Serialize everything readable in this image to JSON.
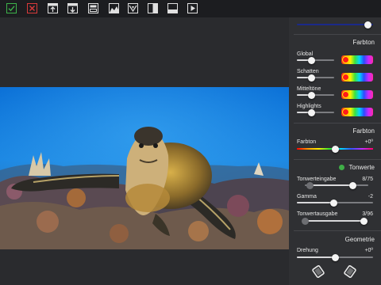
{
  "toolbar": {
    "items": [
      {
        "name": "accept-button",
        "icon": "checkmark-icon",
        "color": "#3db34a"
      },
      {
        "name": "cancel-button",
        "icon": "close-icon",
        "color": "#d93a3a"
      },
      {
        "name": "export-button",
        "icon": "arrow-up-icon"
      },
      {
        "name": "import-button",
        "icon": "arrow-down-icon"
      },
      {
        "name": "compare-button",
        "icon": "split-view-icon"
      },
      {
        "name": "histogram-button",
        "icon": "histogram-icon"
      },
      {
        "name": "auto-adjust-button",
        "icon": "auto-adjust-icon"
      },
      {
        "name": "before-after-button",
        "icon": "before-after-icon"
      },
      {
        "name": "crop-button",
        "icon": "crop-icon"
      },
      {
        "name": "play-button",
        "icon": "play-icon"
      }
    ]
  },
  "panel": {
    "top_slider": {
      "value": 0.93
    },
    "farbton_section": {
      "title": "Farbton",
      "rows": [
        {
          "label": "Global",
          "value": 0.4
        },
        {
          "label": "Schatten",
          "value": 0.4
        },
        {
          "label": "Mitteltöne",
          "value": 0.4
        },
        {
          "label": "Highlights",
          "value": 0.4
        }
      ]
    },
    "farbton2_section": {
      "title": "Farbton",
      "label": "Farbton",
      "value_text": "+0º",
      "value": 0.5
    },
    "tonwerte_section": {
      "title": "Tonwerte",
      "enabled_color": "#3fae47",
      "rows": [
        {
          "label": "Tonwerteingabe",
          "value_text": "8/75",
          "low": 0.08,
          "high": 0.75
        },
        {
          "label": "Gamma",
          "value_text": "-2",
          "value": 0.48
        },
        {
          "label": "Tonwertausgabe",
          "value_text": "3/96",
          "low": 0.03,
          "high": 0.96
        }
      ]
    },
    "geometrie_section": {
      "title": "Geometrie",
      "label": "Drehung",
      "value_text": "+0º",
      "value": 0.5,
      "buttons": [
        {
          "name": "rotate-left-button",
          "icon": "rotate-left-icon"
        },
        {
          "name": "rotate-right-button",
          "icon": "rotate-right-icon"
        }
      ]
    }
  }
}
